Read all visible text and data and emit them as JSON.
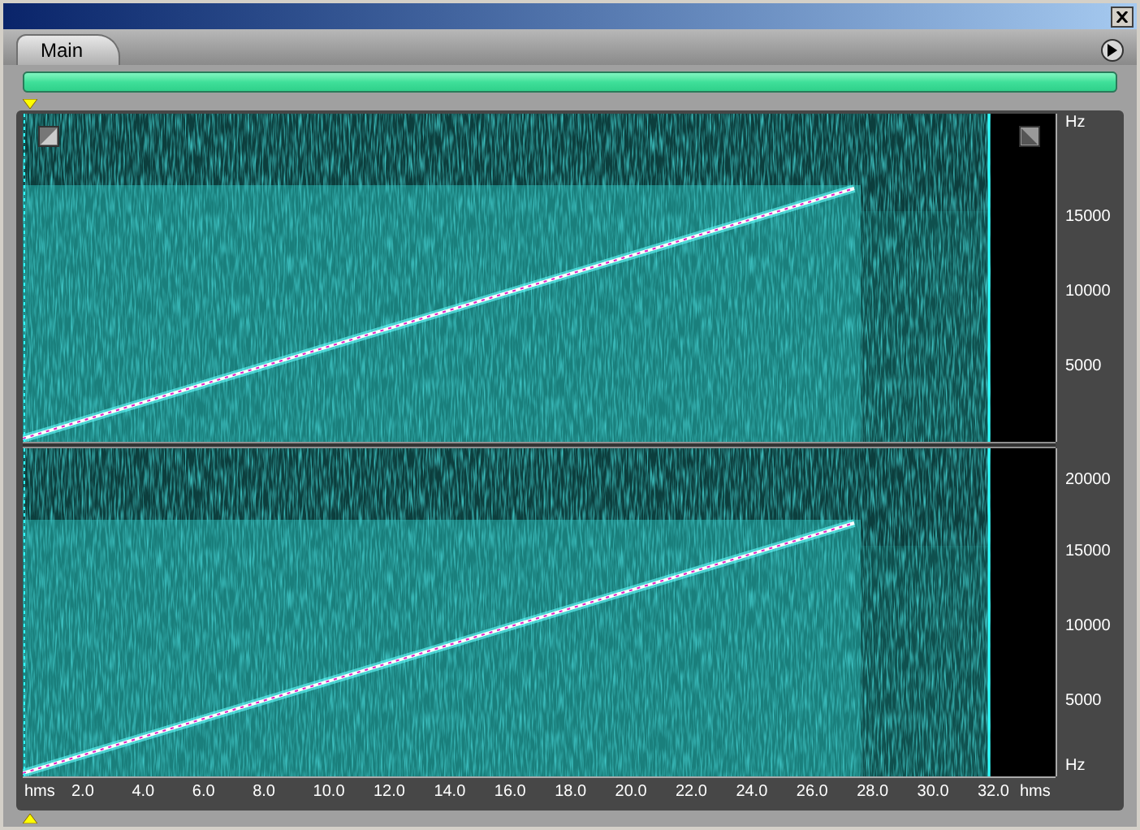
{
  "tabs": [
    {
      "label": "Main",
      "selected": true
    }
  ],
  "overview_bar": {
    "level": 1
  },
  "channels": [
    {
      "freq_labels": [
        "Hz",
        "15000",
        "10000",
        "5000"
      ]
    },
    {
      "freq_labels": [
        "20000",
        "15000",
        "10000",
        "5000",
        "Hz"
      ]
    }
  ],
  "time_axis": {
    "labels": [
      "hms",
      "2.0",
      "4.0",
      "6.0",
      "8.0",
      "10.0",
      "12.0",
      "14.0",
      "16.0",
      "18.0",
      "20.0",
      "22.0",
      "24.0",
      "26.0",
      "28.0",
      "30.0",
      "32.0",
      "hms"
    ]
  }
}
